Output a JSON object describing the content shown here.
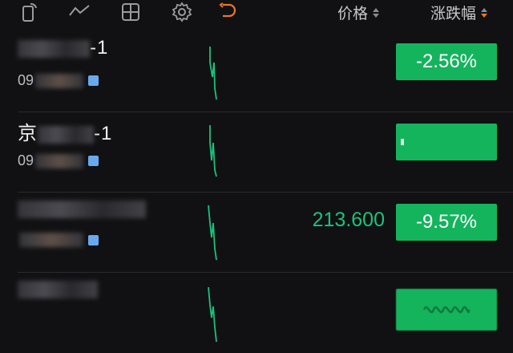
{
  "header": {
    "price_label": "价格",
    "change_label": "涨跌幅",
    "icons": [
      "rotate-phone-icon",
      "trend-line-icon",
      "grid-icon",
      "gear-icon",
      "undo-icon"
    ],
    "accent_color": "#e9762b"
  },
  "rows": [
    {
      "name_prefix": "",
      "name_suffix": "-1",
      "code_prefix": "09",
      "price": "",
      "change": "-2.56%"
    },
    {
      "name_prefix": "京",
      "name_suffix": "-1",
      "code_prefix": "09",
      "price": "",
      "change": ""
    },
    {
      "name_prefix": "",
      "name_suffix": "",
      "code_prefix": "",
      "price": "213.600",
      "change": "-9.57%"
    },
    {
      "name_prefix": "",
      "name_suffix": "",
      "code_prefix": "",
      "price": "",
      "change": ""
    }
  ],
  "colors": {
    "up_green": "#14b45c",
    "price_green": "#19c37d",
    "background": "#111113"
  }
}
